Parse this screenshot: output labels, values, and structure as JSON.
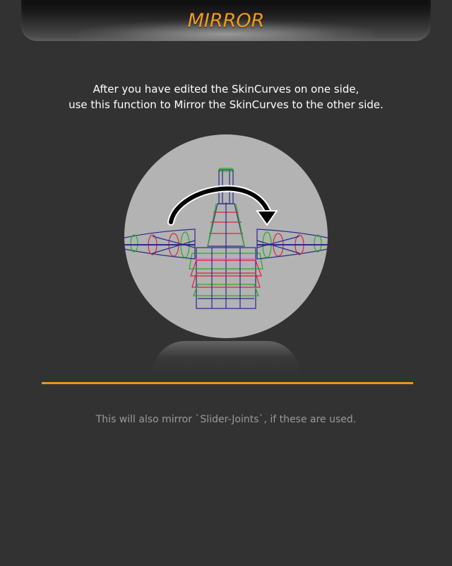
{
  "header": {
    "title": "MIRROR"
  },
  "intro": {
    "line1": "After you have edited the SkinCurves on one side,",
    "line2": "use this function to Mirror the SkinCurves to the other side."
  },
  "illustration": {
    "icon": "mirror-skincurves-icon"
  },
  "footnote": {
    "text": "This will also mirror `Slider-Joints`, if these are used."
  },
  "colors": {
    "accent": "#f29a1c",
    "background": "#323232",
    "divider": "#e8951c"
  }
}
